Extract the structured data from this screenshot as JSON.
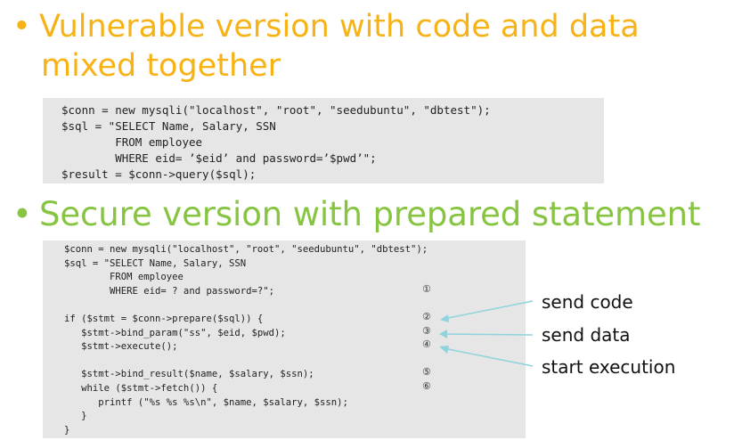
{
  "bullet_symbol": "•",
  "heading1": {
    "line1": "Vulnerable version with code and data",
    "line2": "mixed together"
  },
  "code_vulnerable": [
    "$conn = new mysqli(\"localhost\", \"root\", \"seedubuntu\", \"dbtest\");",
    "$sql = \"SELECT Name, Salary, SSN",
    "        FROM employee",
    "        WHERE eid= ’$eid’ and password=’$pwd’\";",
    "$result = $conn->query($sql);"
  ],
  "heading2": "Secure version with prepared statement",
  "code_secure": [
    "$conn = new mysqli(\"localhost\", \"root\", \"seedubuntu\", \"dbtest\");",
    "$sql = \"SELECT Name, Salary, SSN",
    "        FROM employee",
    "        WHERE eid= ? and password=?\";",
    "",
    "if ($stmt = $conn->prepare($sql)) {",
    "   $stmt->bind_param(\"ss\", $eid, $pwd);",
    "   $stmt->execute();",
    "",
    "   $stmt->bind_result($name, $salary, $ssn);",
    "   while ($stmt->fetch()) {",
    "      printf (\"%s %s %s\\n\", $name, $salary, $ssn);",
    "   }",
    "}"
  ],
  "markers": [
    "①",
    "②",
    "③",
    "④",
    "⑤",
    "⑥"
  ],
  "annotations": {
    "send_code": "send code",
    "send_data": "send data",
    "start_execution": "start execution"
  },
  "arrow_color": "#8fd3dd"
}
